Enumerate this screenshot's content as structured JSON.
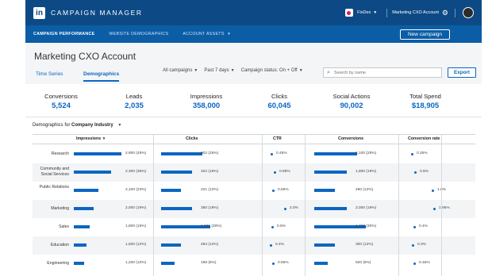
{
  "app": {
    "logo": "in",
    "title": "CAMPAIGN MANAGER"
  },
  "topbar": {
    "account_name": "FixDex",
    "account_label": "Marketing CXO Account",
    "gear_icon": "gear-icon",
    "avatar_icon": "avatar"
  },
  "nav": {
    "items": [
      {
        "label": "CAMPAIGN PERFORMANCE"
      },
      {
        "label": "WEBSITE DEMOGRAPHICS"
      },
      {
        "label": "ACCOUNT ASSETS"
      }
    ],
    "new_campaign": "New campaign"
  },
  "header": {
    "title": "Marketing CXO Account",
    "tabs": [
      {
        "label": "Time Series"
      },
      {
        "label": "Demographics"
      }
    ],
    "filters": [
      {
        "label": "All campaigns"
      },
      {
        "label": "Past 7 days"
      },
      {
        "label": "Campaign status: On + Off"
      }
    ],
    "search_placeholder": "Search by name",
    "export": "Export"
  },
  "summary": [
    {
      "label": "Conversions",
      "value": "5,524"
    },
    {
      "label": "Leads",
      "value": "2,035"
    },
    {
      "label": "Impressions",
      "value": "358,000"
    },
    {
      "label": "Clicks",
      "value": "60,045"
    },
    {
      "label": "Social Actions",
      "value": "90,002"
    },
    {
      "label": "Total Spend",
      "value": "$18,905"
    }
  ],
  "demographics": {
    "prefix": "Demographics for",
    "dimension": "Company Industry",
    "columns": {
      "impressions": "Impressions",
      "clicks": "Clicks",
      "ctr": "CTR",
      "conversions": "Conversions",
      "conv_rate": "Conversion rate"
    },
    "rows": [
      {
        "label": "Research",
        "impressions": "2,800 (45%)",
        "imp_pct": 0.45,
        "clicks": "902 (25%)",
        "clk_pct": 0.25,
        "ctr": "0.45%",
        "ctr_v": 0.45,
        "conversions": "2,100 (25%)",
        "conv_pct": 0.25,
        "rate": "0.25%",
        "rate_v": 0.25
      },
      {
        "label": "Community and Social Services",
        "impressions": "2,300 (35%)",
        "imp_pct": 0.35,
        "clicks": "322 (19%)",
        "clk_pct": 0.19,
        "ctr": "0.85%",
        "ctr_v": 0.85,
        "conversions": "1,800 (19%)",
        "conv_pct": 0.19,
        "rate": "0.5%",
        "rate_v": 0.5
      },
      {
        "label": "Public Relations",
        "impressions": "2,100 (23%)",
        "imp_pct": 0.23,
        "clicks": "221 (12%)",
        "clk_pct": 0.12,
        "ctr": "0.65%",
        "ctr_v": 0.65,
        "conversions": "290 (12%)",
        "conv_pct": 0.12,
        "rate": "1.8%",
        "rate_v": 1.8
      },
      {
        "label": "Marketing",
        "impressions": "2,000 (19%)",
        "imp_pct": 0.19,
        "clicks": "350 (19%)",
        "clk_pct": 0.19,
        "ctr": "2.0%",
        "ctr_v": 2.0,
        "conversions": "2,000 (19%)",
        "conv_pct": 0.19,
        "rate": "1.95%",
        "rate_v": 1.95
      },
      {
        "label": "Sales",
        "impressions": "1,800 (15%)",
        "imp_pct": 0.15,
        "clicks": "1,501 (30%)",
        "clk_pct": 0.3,
        "ctr": "0.5%",
        "ctr_v": 0.5,
        "conversions": "1,200 (30%)",
        "conv_pct": 0.3,
        "rate": "0.4%",
        "rate_v": 0.4
      },
      {
        "label": "Education",
        "impressions": "1,500 (12%)",
        "imp_pct": 0.12,
        "clicks": "284 (12%)",
        "clk_pct": 0.12,
        "ctr": "0.4%",
        "ctr_v": 0.4,
        "conversions": "300 (12%)",
        "conv_pct": 0.12,
        "rate": "0.3%",
        "rate_v": 0.3
      },
      {
        "label": "Engineering",
        "impressions": "1,200 (10%)",
        "imp_pct": 0.1,
        "clicks": "198 (8%)",
        "clk_pct": 0.08,
        "ctr": "0.65%",
        "ctr_v": 0.65,
        "conversions": "920 (8%)",
        "conv_pct": 0.08,
        "rate": "0.45%",
        "rate_v": 0.45
      }
    ]
  },
  "colors": {
    "brand_dark": "#0d4a85",
    "brand_nav": "#0b5da6",
    "accent": "#0b66c2"
  }
}
